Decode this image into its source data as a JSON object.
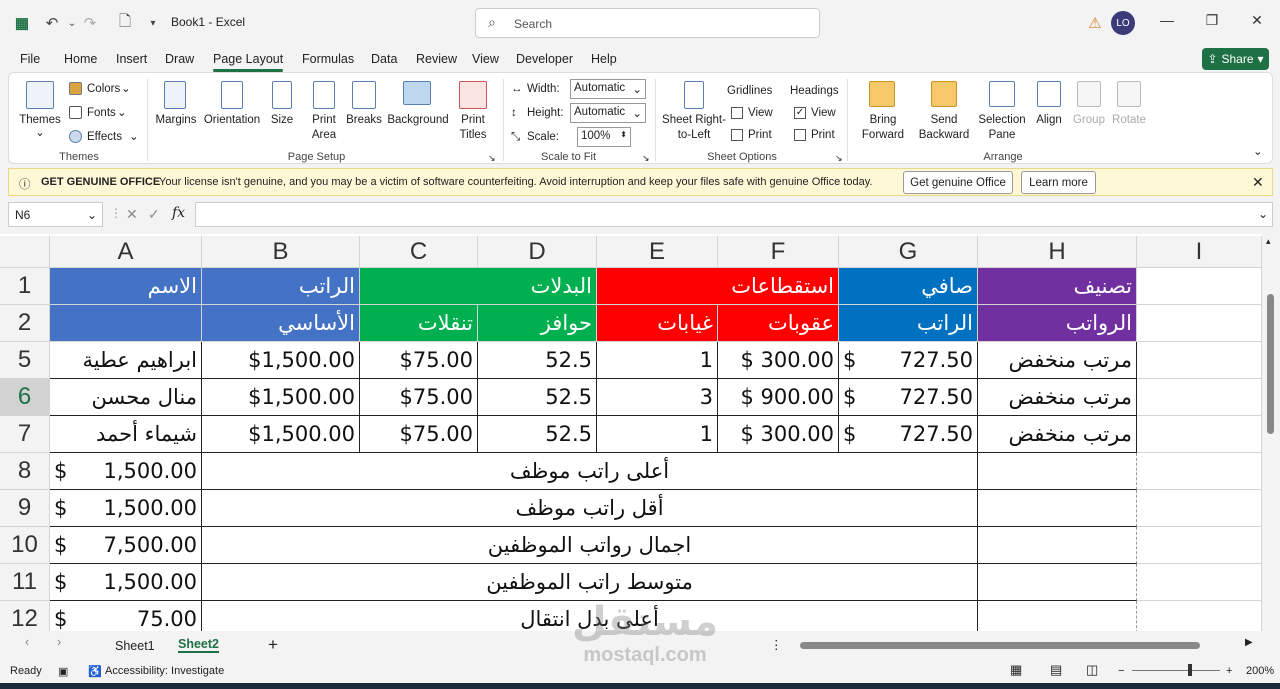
{
  "title_bar": {
    "doc_title": "Book1  -  Excel",
    "search_placeholder": "Search",
    "avatar_initials": "LO",
    "warning_icon": "warning-icon"
  },
  "menu": {
    "tabs": [
      "File",
      "Home",
      "Insert",
      "Draw",
      "Page Layout",
      "Formulas",
      "Data",
      "Review",
      "View",
      "Developer",
      "Help"
    ],
    "active": "Page Layout",
    "share": "Share"
  },
  "ribbon": {
    "themes": {
      "themes": "Themes",
      "colors": "Colors",
      "fonts": "Fonts",
      "effects": "Effects",
      "group": "Themes"
    },
    "page_setup": {
      "margins": "Margins",
      "orientation": "Orientation",
      "size": "Size",
      "print_area_1": "Print",
      "print_area_2": "Area",
      "breaks": "Breaks",
      "background": "Background",
      "print_titles_1": "Print",
      "print_titles_2": "Titles",
      "group": "Page Setup"
    },
    "scale_to_fit": {
      "width_label": "Width:",
      "width_value": "Automatic",
      "height_label": "Height:",
      "height_value": "Automatic",
      "scale_label": "Scale:",
      "scale_value": "100%",
      "group": "Scale to Fit"
    },
    "sheet_options": {
      "rtl_1": "Sheet Right-",
      "rtl_2": "to-Left",
      "gridlines": "Gridlines",
      "headings": "Headings",
      "view": "View",
      "print": "Print",
      "gridlines_view": false,
      "gridlines_print": false,
      "headings_view": true,
      "headings_print": false,
      "group": "Sheet Options"
    },
    "arrange": {
      "bring_1": "Bring",
      "bring_2": "Forward",
      "send_1": "Send",
      "send_2": "Backward",
      "sel_1": "Selection",
      "sel_2": "Pane",
      "align": "Align",
      "group_btn": "Group",
      "rotate": "Rotate",
      "group": "Arrange"
    }
  },
  "license_bar": {
    "title": "GET GENUINE OFFICE",
    "message": "Your license isn't genuine, and you may be a victim of software counterfeiting. Avoid interruption and keep your files safe with genuine Office today.",
    "btn_get": "Get genuine Office",
    "btn_learn": "Learn more"
  },
  "formula_bar": {
    "name_box": "N6",
    "formula": ""
  },
  "grid": {
    "columns": [
      "A",
      "B",
      "C",
      "D",
      "E",
      "F",
      "G",
      "H",
      "I"
    ],
    "row_numbers": [
      "1",
      "2",
      "5",
      "6",
      "7",
      "8",
      "9",
      "10",
      "11",
      "12"
    ],
    "selected_row": "6",
    "header_row1": {
      "name": "الاسم",
      "salary": "الراتب",
      "allowances": "البدلات",
      "deductions": "استقطاعات",
      "net": "صافي",
      "class": "تصنيف"
    },
    "header_row2": {
      "basic": "الأساسي",
      "transport": "تنقلات",
      "incentives": "حوافز",
      "absences": "غيابات",
      "penalties": "عقوبات",
      "net_salary": "الراتب",
      "salaries": "الرواتب"
    },
    "rows": [
      {
        "name": "ابراهيم عطية",
        "basic": "$1,500.00",
        "transport": "$75.00",
        "incentives": "52.5",
        "absences": "1",
        "penalties": "$ 300.00",
        "net_cur": "$",
        "net": "727.50",
        "class": "مرتب منخفض"
      },
      {
        "name": "منال محسن",
        "basic": "$1,500.00",
        "transport": "$75.00",
        "incentives": "52.5",
        "absences": "3",
        "penalties": "$ 900.00",
        "net_cur": "$",
        "net": "727.50",
        "class": "مرتب منخفض"
      },
      {
        "name": "شيماء أحمد",
        "basic": "$1,500.00",
        "transport": "$75.00",
        "incentives": "52.5",
        "absences": "1",
        "penalties": "$ 300.00",
        "net_cur": "$",
        "net": "727.50",
        "class": "مرتب منخفض"
      }
    ],
    "summary": [
      {
        "cur": "$",
        "value": "1,500.00",
        "label": "أعلى راتب موظف"
      },
      {
        "cur": "$",
        "value": "1,500.00",
        "label": "أقل راتب موظف"
      },
      {
        "cur": "$",
        "value": "7,500.00",
        "label": "اجمال رواتب الموظفين"
      },
      {
        "cur": "$",
        "value": "1,500.00",
        "label": "متوسط راتب الموظفين"
      },
      {
        "cur": "$",
        "value": "75.00",
        "label": "أعلى بدل انتقال"
      }
    ],
    "colors": {
      "blue": "#4472c4",
      "green": "#00b050",
      "red": "#ff0000",
      "blue2": "#0070c0",
      "purple": "#7030a0"
    }
  },
  "sheets": {
    "tabs": [
      "Sheet1",
      "Sheet2"
    ],
    "active": "Sheet2"
  },
  "status": {
    "ready": "Ready",
    "accessibility": "Accessibility: Investigate",
    "zoom": "200%"
  },
  "watermark": {
    "line1": "مستقل",
    "line2": "mostaql.com"
  }
}
